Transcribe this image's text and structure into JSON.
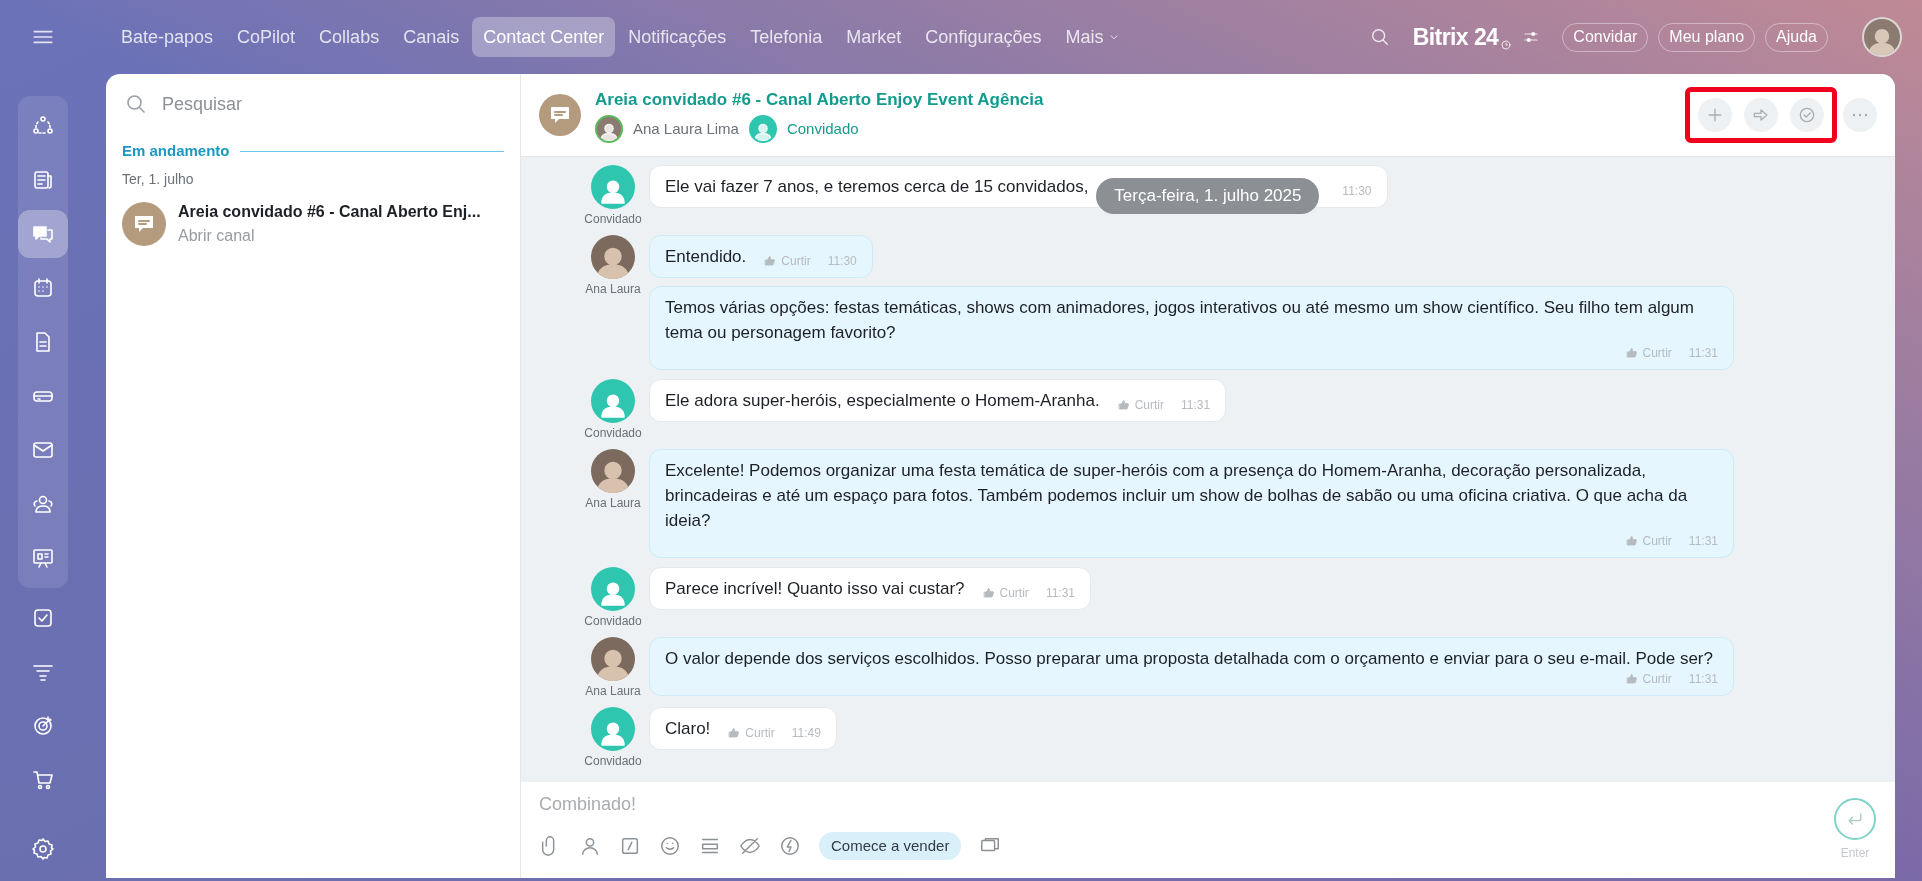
{
  "top_nav": {
    "items": [
      {
        "label": "Bate-papos",
        "selected": false
      },
      {
        "label": "CoPilot",
        "selected": false
      },
      {
        "label": "Collabs",
        "selected": false
      },
      {
        "label": "Canais",
        "selected": false
      },
      {
        "label": "Contact Center",
        "selected": true
      },
      {
        "label": "Notificações",
        "selected": false
      },
      {
        "label": "Telefonia",
        "selected": false
      },
      {
        "label": "Market",
        "selected": false
      },
      {
        "label": "Configurações",
        "selected": false
      },
      {
        "label": "Mais",
        "selected": false,
        "dropdown": true
      }
    ],
    "logo": "Bitrix 24",
    "buttons": [
      "Convidar",
      "Meu plano",
      "Ajuda"
    ]
  },
  "rail_items": [
    {
      "selected": false,
      "in_group": true
    },
    {
      "selected": false,
      "in_group": true
    },
    {
      "selected": true,
      "in_group": true
    },
    {
      "selected": false,
      "in_group": true
    },
    {
      "selected": false,
      "in_group": true
    },
    {
      "selected": false,
      "in_group": true
    },
    {
      "selected": false,
      "in_group": true
    },
    {
      "selected": false,
      "in_group": true
    },
    {
      "selected": false,
      "in_group": true
    },
    {
      "selected": false,
      "in_group": false
    },
    {
      "selected": false,
      "in_group": false
    },
    {
      "selected": false,
      "in_group": false
    },
    {
      "selected": false,
      "in_group": false
    }
  ],
  "chat_list": {
    "search": {
      "placeholder": "Pesquisar"
    },
    "section": "Em andamento",
    "date": "Ter, 1. julho",
    "items": [
      {
        "title": "Areia convidado #6 - Canal Aberto Enj...",
        "subtitle": "Abrir canal",
        "selected": false
      }
    ]
  },
  "chat": {
    "title": "Areia convidado #6 - Canal Aberto Enjoy Event Agência",
    "members": [
      {
        "kind": "agent",
        "name": "Ana Laura Lima"
      },
      {
        "kind": "guest",
        "name": "Convidado"
      }
    ],
    "date_badge": "Terça-feira, 1. julho 2025",
    "groups": [
      {
        "kind": "guest",
        "author": "Convidado",
        "messages": [
          {
            "text": "Ele vai fazer 7 anos, e teremos cerca de 15 convidados,",
            "badge_over": true,
            "time": "11:30"
          }
        ]
      },
      {
        "kind": "agent",
        "author": "Ana Laura",
        "messages": [
          {
            "text": "Entendido.",
            "like": "Curtir",
            "time": "11:30"
          },
          {
            "text": "Temos várias opções: festas temáticas, shows com animadores, jogos interativos ou até mesmo um show científico. Seu filho tem algum tema ou personagem favorito?",
            "like": "Curtir",
            "time": "11:31"
          }
        ]
      },
      {
        "kind": "guest",
        "author": "Convidado",
        "messages": [
          {
            "text": "Ele adora super-heróis, especialmente o Homem-Aranha.",
            "like": "Curtir",
            "time": "11:31"
          }
        ]
      },
      {
        "kind": "agent",
        "author": "Ana Laura",
        "messages": [
          {
            "text": "Excelente! Podemos organizar uma festa temática de super-heróis com a presença do Homem-Aranha, decoração personalizada, brincadeiras e até um espaço para fotos. Também podemos incluir um show de bolhas de sabão ou uma oficina criativa. O que acha da ideia?",
            "like": "Curtir",
            "time": "11:31"
          }
        ]
      },
      {
        "kind": "guest",
        "author": "Convidado",
        "messages": [
          {
            "text": "Parece incrível! Quanto isso vai custar?",
            "like": "Curtir",
            "time": "11:31"
          }
        ]
      },
      {
        "kind": "agent",
        "author": "Ana Laura",
        "messages": [
          {
            "text": "O valor depende dos serviços escolhidos. Posso preparar uma proposta detalhada com o orçamento e enviar para o seu e-mail. Pode ser?",
            "like": "Curtir",
            "time": "11:31"
          }
        ]
      },
      {
        "kind": "guest",
        "author": "Convidado",
        "messages": [
          {
            "text": "Claro!",
            "like": "Curtir",
            "time": "11:49"
          }
        ]
      }
    ],
    "input": {
      "placeholder": "Combinado!",
      "sell_button": "Comece a vender",
      "send_hint": "Enter"
    }
  }
}
